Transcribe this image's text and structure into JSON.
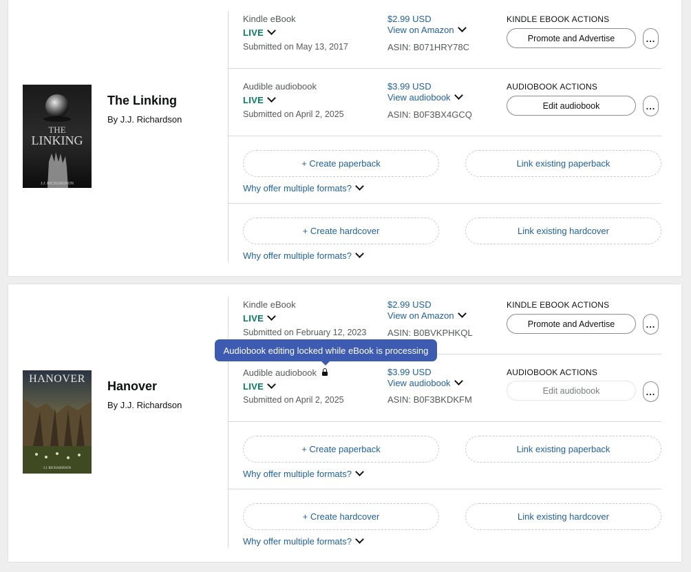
{
  "books": [
    {
      "title": "The Linking",
      "author": "By J.J. Richardson",
      "cover_text": "THE LINKING",
      "cover_author": "J.J. RICHARDSON",
      "ebook": {
        "format": "Kindle eBook",
        "status": "LIVE",
        "submitted": "Submitted on May 13, 2017",
        "price": "$2.99 USD",
        "view_link": "View on Amazon",
        "asin": "ASIN: B071HRY78C",
        "actions_label": "KINDLE EBOOK ACTIONS",
        "action_button": "Promote and Advertise",
        "more": "..."
      },
      "audiobook": {
        "format": "Audible audiobook",
        "status": "LIVE",
        "submitted": "Submitted on April 2, 2025",
        "price": "$3.99 USD",
        "view_link": "View audiobook",
        "asin": "ASIN: B0F3BX4GCQ",
        "actions_label": "AUDIOBOOK ACTIONS",
        "action_button": "Edit audiobook",
        "more": "..."
      },
      "paperback": {
        "create": "+ Create paperback",
        "link": "Link existing paperback",
        "why": "Why offer multiple formats?"
      },
      "hardcover": {
        "create": "+ Create hardcover",
        "link": "Link existing hardcover",
        "why": "Why offer multiple formats?"
      }
    },
    {
      "title": "Hanover",
      "author": "By J.J. Richardson",
      "cover_text": "HANOVER",
      "cover_author": "J.J. RICHARDSON",
      "ebook": {
        "format": "Kindle eBook",
        "status": "LIVE",
        "submitted": "Submitted on February 12, 2023",
        "price": "$2.99 USD",
        "view_link": "View on Amazon",
        "asin": "ASIN: B0BVKPHKQL",
        "actions_label": "KINDLE EBOOK ACTIONS",
        "action_button": "Promote and Advertise",
        "more": "..."
      },
      "audiobook": {
        "format": "Audible audiobook",
        "status": "LIVE",
        "submitted": "Submitted on April 2, 2025",
        "price": "$3.99 USD",
        "view_link": "View audiobook",
        "asin": "ASIN: B0F3BKDKFM",
        "actions_label": "AUDIOBOOK ACTIONS",
        "action_button": "Edit audiobook",
        "more": "...",
        "locked_icon": "lock-icon"
      },
      "paperback": {
        "create": "+ Create paperback",
        "link": "Link existing paperback",
        "why": "Why offer multiple formats?"
      },
      "hardcover": {
        "create": "+ Create hardcover",
        "link": "Link existing hardcover",
        "why": "Why offer multiple formats?"
      }
    }
  ],
  "tooltip": "Audiobook editing locked while eBook is processing",
  "colors": {
    "live": "#067d62",
    "link": "#2162a1",
    "tooltip": "#3d5bb0"
  }
}
